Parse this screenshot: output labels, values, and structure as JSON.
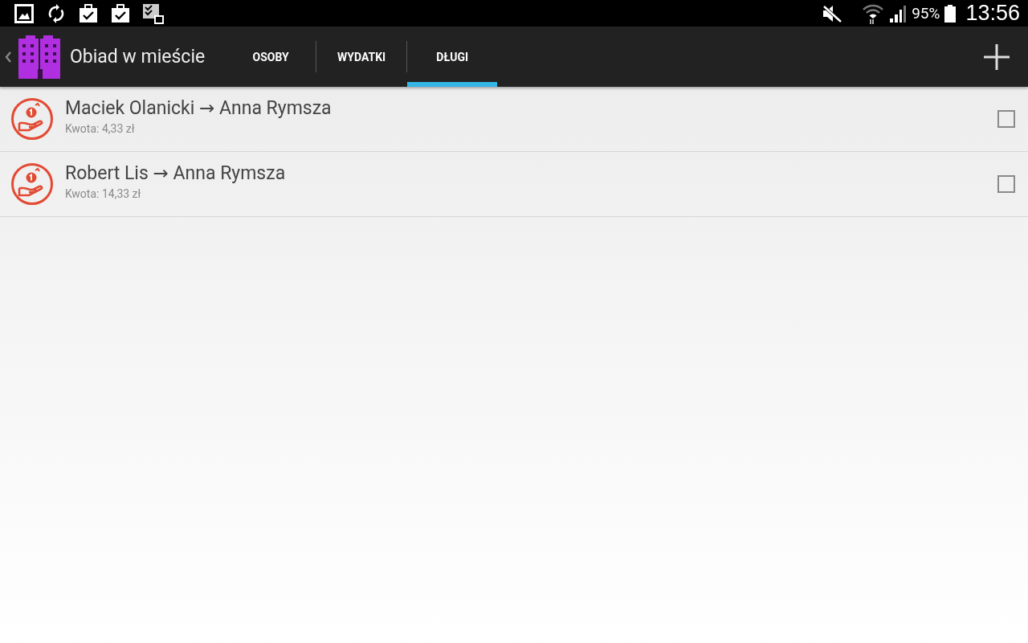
{
  "status_bar": {
    "battery_percent": "95%",
    "time": "13:56"
  },
  "action_bar": {
    "title": "Obiad w mieście"
  },
  "tabs": [
    {
      "label": "OSOBY",
      "selected": false
    },
    {
      "label": "WYDATKI",
      "selected": false
    },
    {
      "label": "DŁUGI",
      "selected": true
    }
  ],
  "debts": [
    {
      "from": "Maciek Olanicki",
      "arrow": "→",
      "to": "Anna Rymsza",
      "amount": "Kwota: 4,33 zł",
      "checked": false
    },
    {
      "from": "Robert Lis",
      "arrow": "→",
      "to": "Anna Rymsza",
      "amount": "Kwota: 14,33 zł",
      "checked": false
    }
  ]
}
